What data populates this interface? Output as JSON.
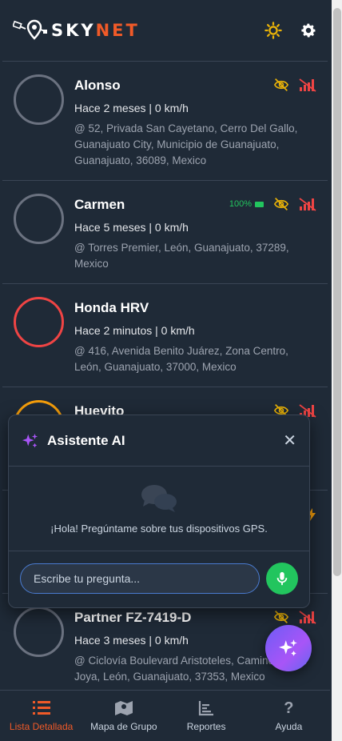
{
  "app": {
    "brand_left": "SKY",
    "brand_right": "NET"
  },
  "colors": {
    "accent": "#f05a28",
    "green": "#22c55e",
    "alert": "#ef4444",
    "warn": "#eab308",
    "orange": "#f59e0b"
  },
  "devices": [
    {
      "name": "Alonso",
      "status": "Hace 2 meses | 0 km/h",
      "address": "@ 52, Privada San Cayetano, Cerro Del Gallo, Guanajuato City, Municipio de Guanajuato, Guanajuato, 36089, Mexico",
      "battery": ""
    },
    {
      "name": "Carmen",
      "status": "Hace 5 meses | 0 km/h",
      "address": "@ Torres Premier, León, Guanajuato, 37289, Mexico",
      "battery": "100%"
    },
    {
      "name": "Honda HRV",
      "status": "Hace 2 minutos | 0 km/h",
      "address": "@ 416, Avenida Benito Juárez, Zona Centro, León, Guanajuato, 37000, Mexico",
      "battery": ""
    },
    {
      "name": "Huevito",
      "status": "",
      "address": "",
      "battery": ""
    },
    {
      "name": "",
      "status": "",
      "address": "",
      "battery": ""
    },
    {
      "name": "Partner FZ-7419-D",
      "status": "Hace 3 meses | 0 km/h",
      "address": "@ Ciclovía Boulevard Aristoteles, Camino De La Joya, León, Guanajuato, 37353, Mexico",
      "battery": ""
    }
  ],
  "ai": {
    "title": "Asistente AI",
    "greeting": "¡Hola! Pregúntame sobre tus dispositivos GPS.",
    "placeholder": "Escribe tu pregunta..."
  },
  "nav": [
    {
      "label": "Lista Detallada",
      "icon": "list-icon",
      "active": true
    },
    {
      "label": "Mapa de Grupo",
      "icon": "map-icon",
      "active": false
    },
    {
      "label": "Reportes",
      "icon": "chart-icon",
      "active": false
    },
    {
      "label": "Ayuda",
      "icon": "question-icon",
      "active": false
    }
  ]
}
